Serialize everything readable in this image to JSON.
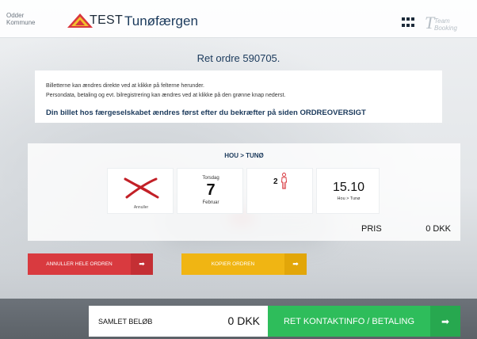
{
  "header": {
    "municipality_line1": "Odder",
    "municipality_line2": "Kommune",
    "environment_label": "TEST",
    "app_title": "Tunøfærgen",
    "logo_text_1": "Team",
    "logo_text_2": "Booking"
  },
  "order": {
    "title": "Ret ordre 590705."
  },
  "info": {
    "line1": "Billetterne kan ændres direkte ved at klikke på felterne herunder.",
    "line2": "Persondata, betaling og evt. bilregistrering kan ændres ved at klikke på den grønne knap nederst.",
    "notice": "Din billet hos færgeselskabet ændres først efter du bekræfter på siden ORDREOVERSIGT"
  },
  "ticket": {
    "route": "HOU > TUNØ",
    "cancel_label": "Annuller",
    "weekday": "Torsdag",
    "day": "7",
    "month": "Februar",
    "passengers": "2",
    "departure_time": "15.10",
    "departure_route": "Hou > Tunø",
    "price_label": "PRIS",
    "price_value": "0 DKK"
  },
  "actions": {
    "cancel_all": "ANNULLER HELE ORDREN",
    "copy": "KOPIER ORDREN",
    "arrow": "➡"
  },
  "footer": {
    "total_label": "SAMLET BELØB",
    "total_value": "0 DKK",
    "pay_button": "RET KONTAKTINFO / BETALING"
  },
  "colors": {
    "accent_navy": "#1b3a5c",
    "danger_red": "#d93a3f",
    "warning_yellow": "#f0b513",
    "success_green": "#2ebd5b"
  },
  "icons": {
    "crest": "municipality-crest-icon",
    "apps": "grid-icon",
    "cancel": "red-x-icon",
    "passenger": "person-icon",
    "arrow": "arrow-right-icon"
  }
}
